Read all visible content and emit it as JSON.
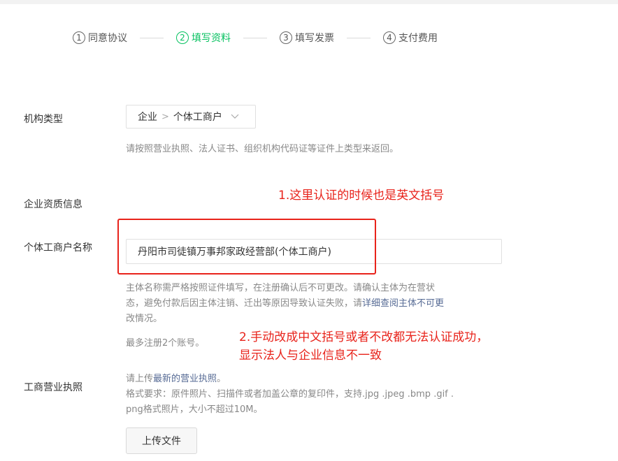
{
  "steps": [
    {
      "num": "1",
      "label": "同意协议"
    },
    {
      "num": "2",
      "label": "填写资料"
    },
    {
      "num": "3",
      "label": "填写发票"
    },
    {
      "num": "4",
      "label": "支付费用"
    }
  ],
  "org_type": {
    "label": "机构类型",
    "level1": "企业",
    "separator": ">",
    "level2": "个体工商户",
    "hint": "请按照营业执照、法人证书、组织机构代码证等证件上类型来返回。"
  },
  "qualification": {
    "section_label": "企业资质信息"
  },
  "name_field": {
    "label": "个体工商户名称",
    "value": "丹阳市司徒镇万事邦家政经营部(个体工商户)",
    "hint_line1": "主体名称需严格按照证件填写，在注册确认后不可更改。请确认主体为在营状",
    "hint_line2_pre": "态，避免付款后因主体注销、迁出等原因导致认证失败，请",
    "hint_link": "详细查阅主体不可更",
    "hint_line3": "改情况。",
    "limit": "最多注册2个账号。"
  },
  "license": {
    "label": "工商营业执照",
    "hint_pre": "请上传",
    "hint_link": "最新的营业执照",
    "hint_post": "。",
    "format_line1": "格式要求：原件照片、扫描件或者加盖公章的复印件，支持.jpg .jpeg .bmp .gif .",
    "format_line2": "png格式照片，大小不超过10M。",
    "upload_label": "上传文件"
  },
  "annotations": {
    "note1": "1.这里认证的时候也是英文括号",
    "note2_line1": "2.手动改成中文括号或者不改都无法认证成功，",
    "note2_line2": "显示法人与企业信息不一致"
  },
  "colors": {
    "accent": "#07c160",
    "annotation": "#e8231b",
    "link": "#576b95"
  }
}
